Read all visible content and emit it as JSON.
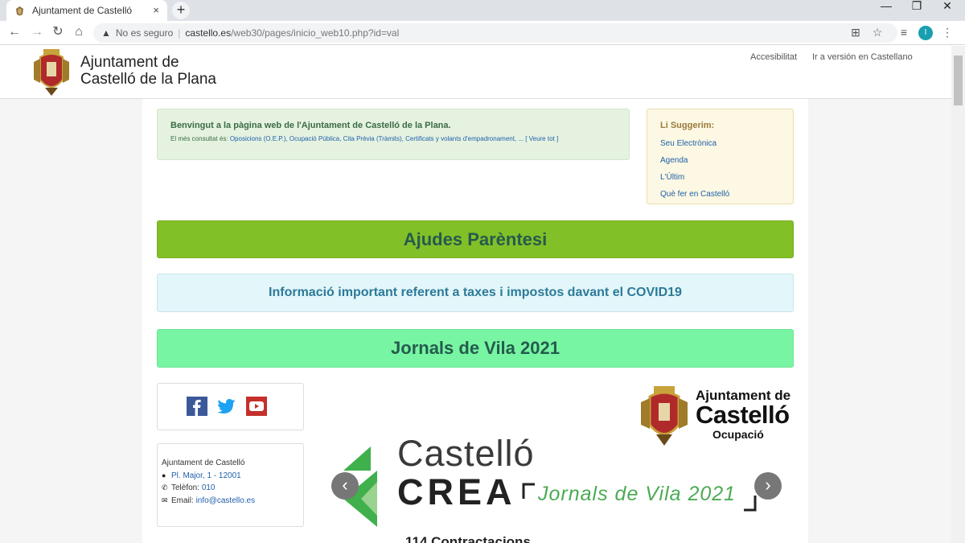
{
  "browser": {
    "tab_title": "Ajuntament de Castelló",
    "tab_close": "×",
    "new_tab": "+",
    "address": {
      "insecure_label": "No es seguro",
      "url_host": "castello.es",
      "url_path": "/web30/pages/inicio_web10.php?id=val"
    },
    "profile_initial": "I"
  },
  "header": {
    "site_name_line1": "Ajuntament de",
    "site_name_line2": "Castelló de la Plana",
    "links": [
      "Accesibilitat",
      "Ir a versión en Castellano"
    ]
  },
  "welcome": {
    "title": "Benvingut a la pàgina web de l'Ajuntament de Castelló de la Plana.",
    "most_consulted_prefix": "El més consultat és:",
    "most_consulted_links": "Oposicions (O.E.P.), Ocupació Pública, Cita Prèvia (Tràmits), Certificats y volants d'empadronament, ...",
    "see_all": "[ Veure tot ]"
  },
  "suggestions": {
    "title": "Li Suggerim:",
    "items": [
      "Seu Electrònica",
      "Agenda",
      "L'Últim",
      "Què fer en Castelló"
    ]
  },
  "banners": {
    "ajudes": "Ajudes Parèntesi",
    "covid": "Informació important referent a taxes i impostos davant el COVID19",
    "jornals": "Jornals de Vila 2021"
  },
  "contact": {
    "name": "Ajuntament de Castelló",
    "address": "Pl. Major, 1 - 12001",
    "phone_label": "Telèfon:",
    "phone": "010",
    "email_label": "Email:",
    "email": "info@castello.es"
  },
  "carousel": {
    "logo_line1": "Ajuntament de",
    "logo_line2": "Castelló",
    "logo_line3": "Ocupació",
    "brand_word1": "Castelló",
    "brand_word2": "CREA",
    "brand_tagline": "Jornals de Vila 2021",
    "caption": "114 Contractacions",
    "prev": "‹",
    "next": "›"
  },
  "colors": {
    "ajudes_bg": "#82c027",
    "covid_bg": "#e3f6f9",
    "jornals_bg": "#78f5a3",
    "link": "#1f5faa",
    "crea_green": "#4cab54"
  }
}
